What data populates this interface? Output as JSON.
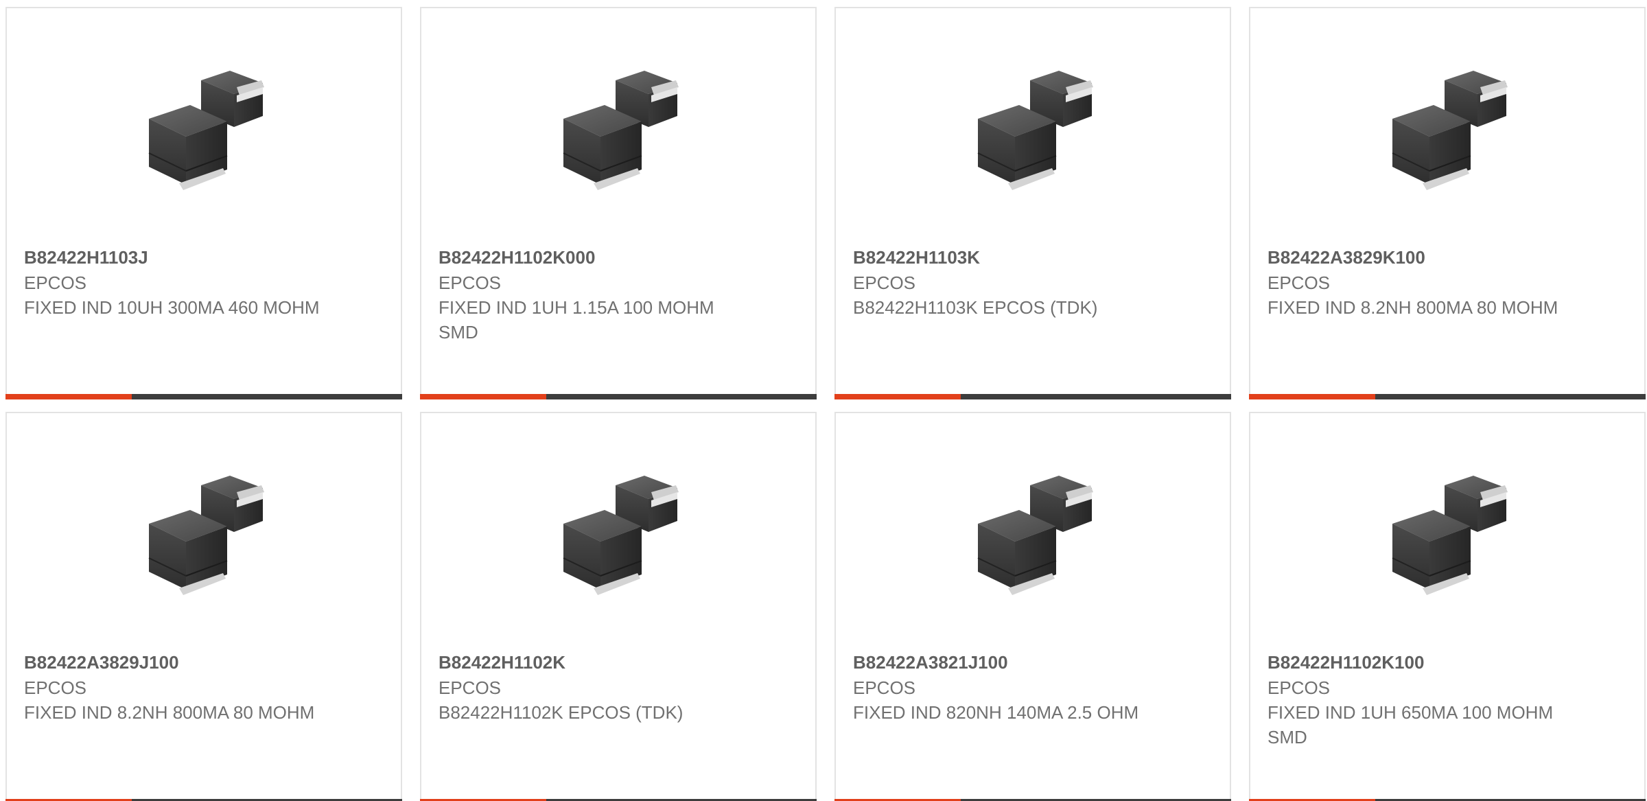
{
  "colors": {
    "accent": "#e2401b",
    "bar": "#3d3d3d",
    "border": "#e3e3e3",
    "text": "#707070"
  },
  "products": [
    {
      "part_number": "B82422H1103J",
      "manufacturer": "EPCOS",
      "description": "FIXED IND 10UH 300MA 460 MOHM",
      "image_icon": "smd-inductor-image"
    },
    {
      "part_number": "B82422H1102K000",
      "manufacturer": "EPCOS",
      "description": "FIXED IND 1UH 1.15A 100 MOHM SMD",
      "image_icon": "smd-inductor-image"
    },
    {
      "part_number": "B82422H1103K",
      "manufacturer": "EPCOS",
      "description": "B82422H1103K EPCOS (TDK)",
      "image_icon": "smd-inductor-image"
    },
    {
      "part_number": "B82422A3829K100",
      "manufacturer": "EPCOS",
      "description": "FIXED IND 8.2NH 800MA 80 MOHM",
      "image_icon": "smd-inductor-image"
    },
    {
      "part_number": "B82422A3829J100",
      "manufacturer": "EPCOS",
      "description": "FIXED IND 8.2NH 800MA 80 MOHM",
      "image_icon": "smd-inductor-image"
    },
    {
      "part_number": "B82422H1102K",
      "manufacturer": "EPCOS",
      "description": "B82422H1102K EPCOS (TDK)",
      "image_icon": "smd-inductor-image"
    },
    {
      "part_number": "B82422A3821J100",
      "manufacturer": "EPCOS",
      "description": "FIXED IND 820NH 140MA 2.5 OHM",
      "image_icon": "smd-inductor-image"
    },
    {
      "part_number": "B82422H1102K100",
      "manufacturer": "EPCOS",
      "description": "FIXED IND 1UH 650MA 100 MOHM SMD",
      "image_icon": "smd-inductor-image"
    }
  ]
}
